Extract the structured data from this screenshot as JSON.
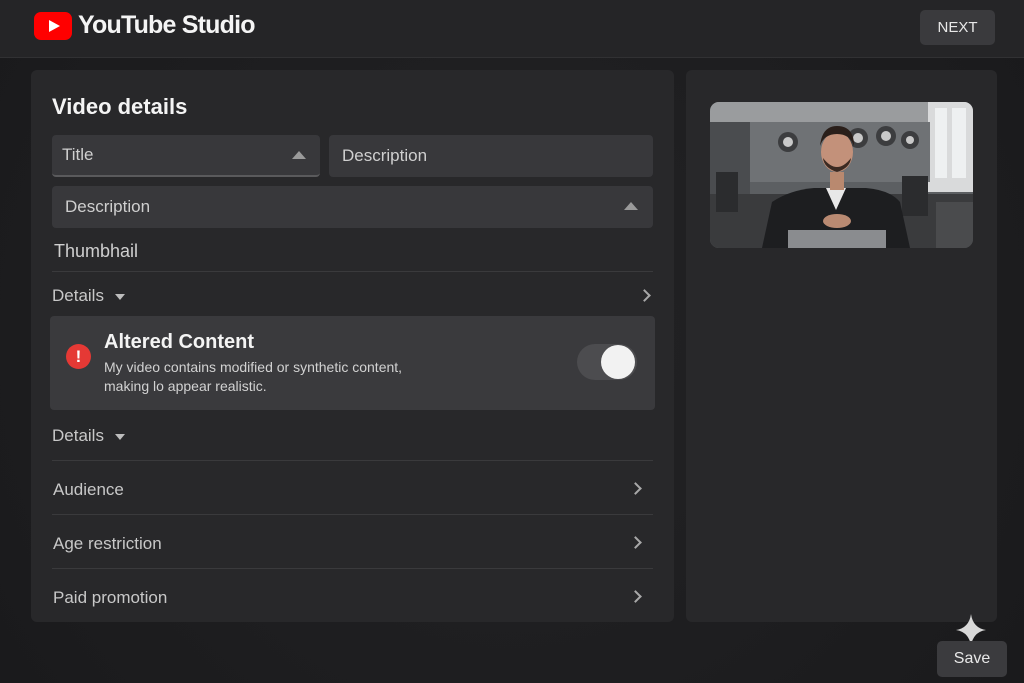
{
  "app": {
    "name": "YouTube Studio"
  },
  "header": {
    "next_label": "NEXT"
  },
  "form": {
    "title": "Video details",
    "title_field": {
      "label": "Title"
    },
    "description_field_a": {
      "label": "Description"
    },
    "description_field_b": {
      "label": "Description"
    },
    "thumbnail_label": "Thumbhail",
    "details_label_1": "Details",
    "details_label_2": "Details"
  },
  "altered_content": {
    "title": "Altered Content",
    "line1": "My video contains modified or synthetic content,",
    "line2": "making lo appear realistic.",
    "toggle_on": true
  },
  "sections": [
    {
      "label": "Audience"
    },
    {
      "label": "Age restriction"
    },
    {
      "label": "Paid promotion"
    }
  ],
  "footer": {
    "save_label": "Save"
  },
  "colors": {
    "accent": "#ff0000",
    "alert": "#e53935"
  }
}
